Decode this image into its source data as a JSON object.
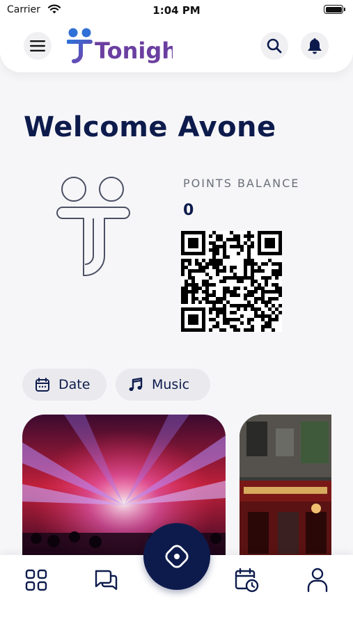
{
  "status_bar": {
    "carrier": "Carrier",
    "time": "1:04 PM"
  },
  "header": {
    "logo_text": "Tonight",
    "menu_icon": "hamburger-menu-icon",
    "search_icon": "search-icon",
    "notification_icon": "bell-icon"
  },
  "welcome": {
    "title": "Welcome Avone"
  },
  "points": {
    "label": "POINTS BALANCE",
    "value": "0"
  },
  "filters": [
    {
      "label": "Date",
      "icon": "calendar-icon"
    },
    {
      "label": "Music",
      "icon": "music-note-icon"
    }
  ],
  "colors": {
    "primary": "#0d1b4c",
    "chip_bg": "#eaeaee",
    "background": "#f6f6f8",
    "accent_purple": "#6b3fa0",
    "accent_blue": "#2f6fd6"
  },
  "bottom_nav": [
    {
      "name": "home",
      "icon": "grid-icon"
    },
    {
      "name": "chat",
      "icon": "chat-bubbles-icon"
    },
    {
      "name": "explore",
      "icon": "compass-icon"
    },
    {
      "name": "bookings",
      "icon": "calendar-clock-icon"
    },
    {
      "name": "profile",
      "icon": "user-icon"
    }
  ]
}
